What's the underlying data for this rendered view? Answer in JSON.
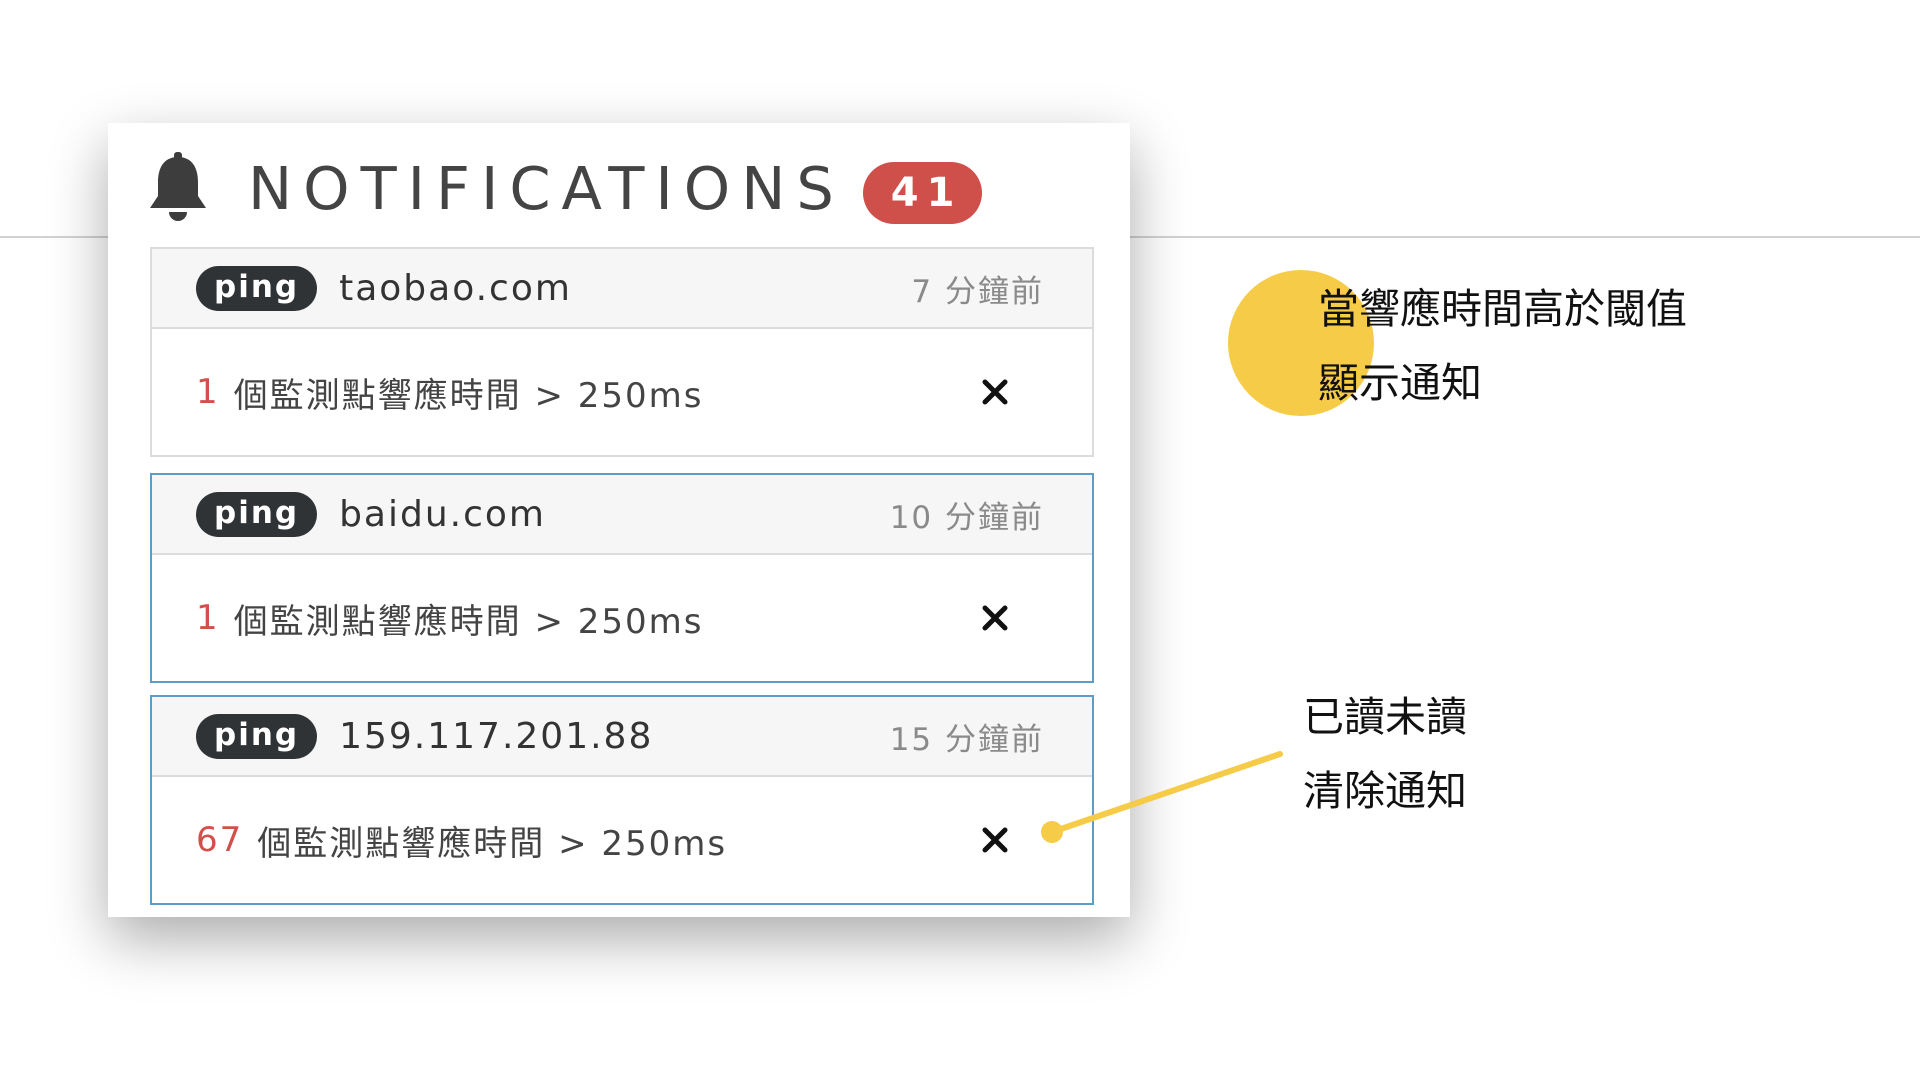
{
  "header": {
    "title": "NOTIFICATIONS",
    "count": "41"
  },
  "notifications": [
    {
      "tag": "ping",
      "host": "taobao.com",
      "time": "7 分鐘前",
      "count": "1",
      "message": "個監測點響應時間 > 250ms",
      "active": false
    },
    {
      "tag": "ping",
      "host": "baidu.com",
      "time": "10 分鐘前",
      "count": "1",
      "message": "個監測點響應時間 > 250ms",
      "active": true
    },
    {
      "tag": "ping",
      "host": "159.117.201.88",
      "time": "15 分鐘前",
      "count": "67",
      "message": "個監測點響應時間 > 250ms",
      "active": true
    }
  ],
  "callouts": {
    "threshold": {
      "line1": "當響應時間高於閾值",
      "line2": "顯示通知"
    },
    "clear": {
      "line1": "已讀未讀",
      "line2": "清除通知"
    }
  },
  "colors": {
    "accent": "#f5cb48",
    "badge": "#cf4f4a",
    "active_border": "#5b9cc9",
    "count_text": "#d2504b"
  },
  "icons": {
    "header": "bell-icon",
    "dismiss": "close-icon"
  }
}
